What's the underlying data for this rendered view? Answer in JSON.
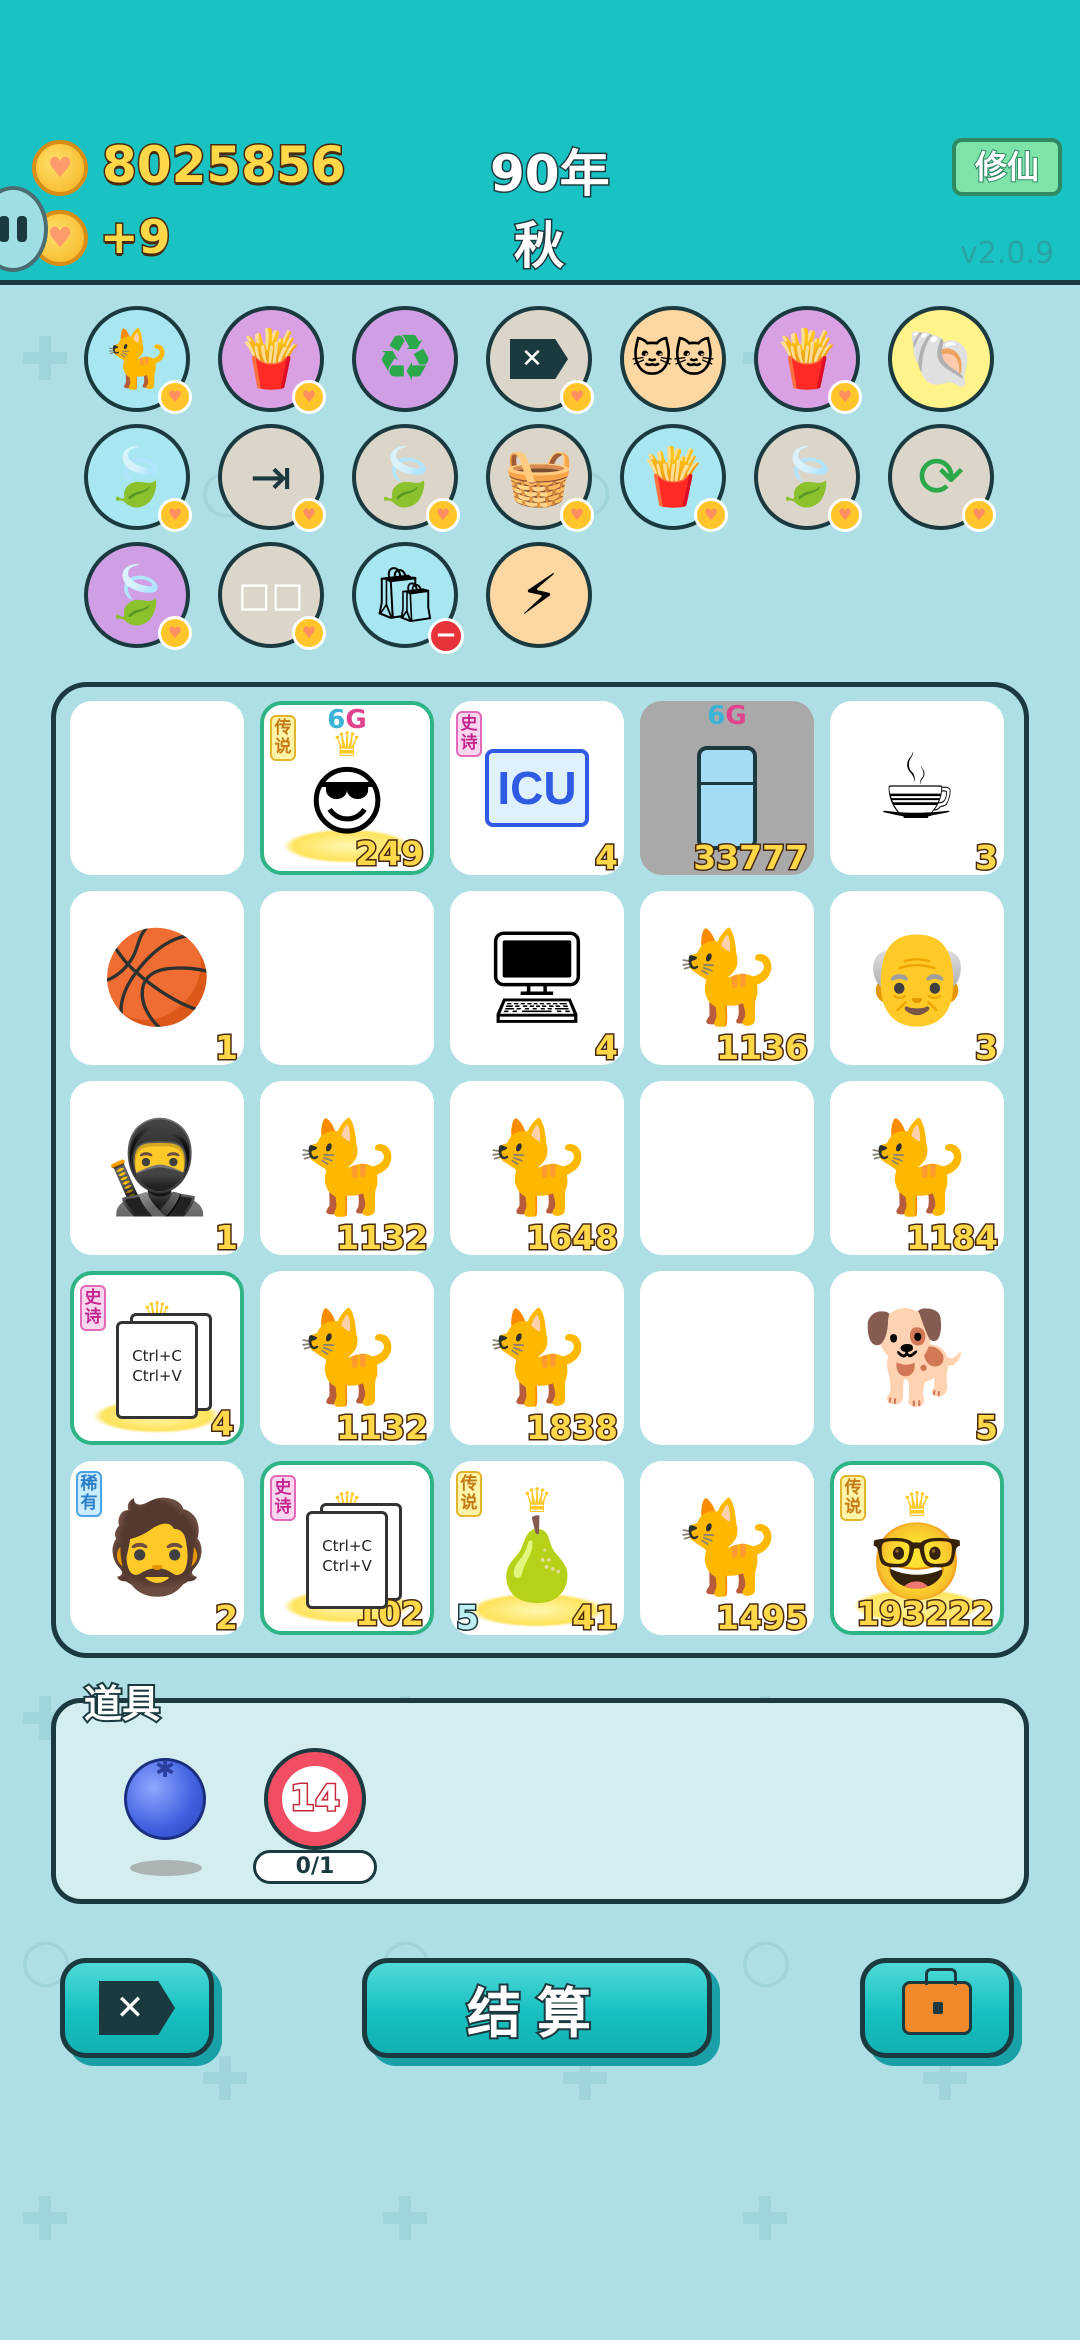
{
  "header": {
    "coins": "8025856",
    "coin_delta": "+9",
    "year": "90年",
    "season": "秋",
    "xiuxian_label": "修仙",
    "version": "v2.0.9"
  },
  "items_row1": [
    "cat-icon",
    "fries-icon",
    "recycle-icon",
    "delete-tag-icon",
    "two-cats-icon",
    "fries-icon",
    "shell-icon"
  ],
  "items_row2": [
    "leaf-icon",
    "skip-icon",
    "leaf-icon",
    "fruit-basket-icon",
    "fries-icon",
    "leaf-icon",
    "refresh-icon"
  ],
  "items_row3": [
    "leaf-icon",
    "sugar-cubes-icon",
    "trash-bag-icon",
    "lightning-icon"
  ],
  "board": {
    "cells": [
      {
        "name": "empty",
        "count": ""
      },
      {
        "name": "sunglasses-guy",
        "rarity": "传说",
        "tag": "6G",
        "count": "249"
      },
      {
        "name": "icu",
        "rarity": "史诗",
        "count": "4"
      },
      {
        "name": "fridge",
        "tag": "6G",
        "count": "33777"
      },
      {
        "name": "coffee-cup",
        "count": "3"
      },
      {
        "name": "basketball",
        "count": "1"
      },
      {
        "name": "empty",
        "count": ""
      },
      {
        "name": "computer",
        "count": "4"
      },
      {
        "name": "cat",
        "count": "1136"
      },
      {
        "name": "old-man",
        "count": "3"
      },
      {
        "name": "thief",
        "count": "1"
      },
      {
        "name": "cat",
        "count": "1132"
      },
      {
        "name": "cat",
        "count": "1648"
      },
      {
        "name": "empty",
        "count": ""
      },
      {
        "name": "cat",
        "count": "1184"
      },
      {
        "name": "ctrl-cv",
        "rarity": "史诗",
        "count": "4"
      },
      {
        "name": "cat",
        "count": "1132"
      },
      {
        "name": "cat",
        "count": "1838"
      },
      {
        "name": "empty",
        "count": ""
      },
      {
        "name": "husky",
        "count": "5"
      },
      {
        "name": "bucket-hat-man",
        "rarity": "稀有",
        "count": "2"
      },
      {
        "name": "ctrl-cv",
        "rarity": "史诗",
        "count": "102"
      },
      {
        "name": "green-pear",
        "rarity": "传说",
        "left_count": "5",
        "count": "41"
      },
      {
        "name": "cat",
        "count": "1495"
      },
      {
        "name": "grinning-old-man",
        "rarity": "传说",
        "count": "193222"
      }
    ],
    "ctrl_text_1": "Ctrl+C",
    "ctrl_text_2": "Ctrl+V",
    "icu_text": "ICU",
    "tag_6": "6",
    "tag_g": "G"
  },
  "props": {
    "title": "道具",
    "timer_value": "14",
    "timer_progress": "0/1"
  },
  "buttons": {
    "settle_label": "结算",
    "delete_label": "✕"
  },
  "colors": {
    "teal": "#19c3c4",
    "bg": "#aedfe5",
    "dark": "#1b3a3f",
    "gold": "#ffd84a"
  }
}
